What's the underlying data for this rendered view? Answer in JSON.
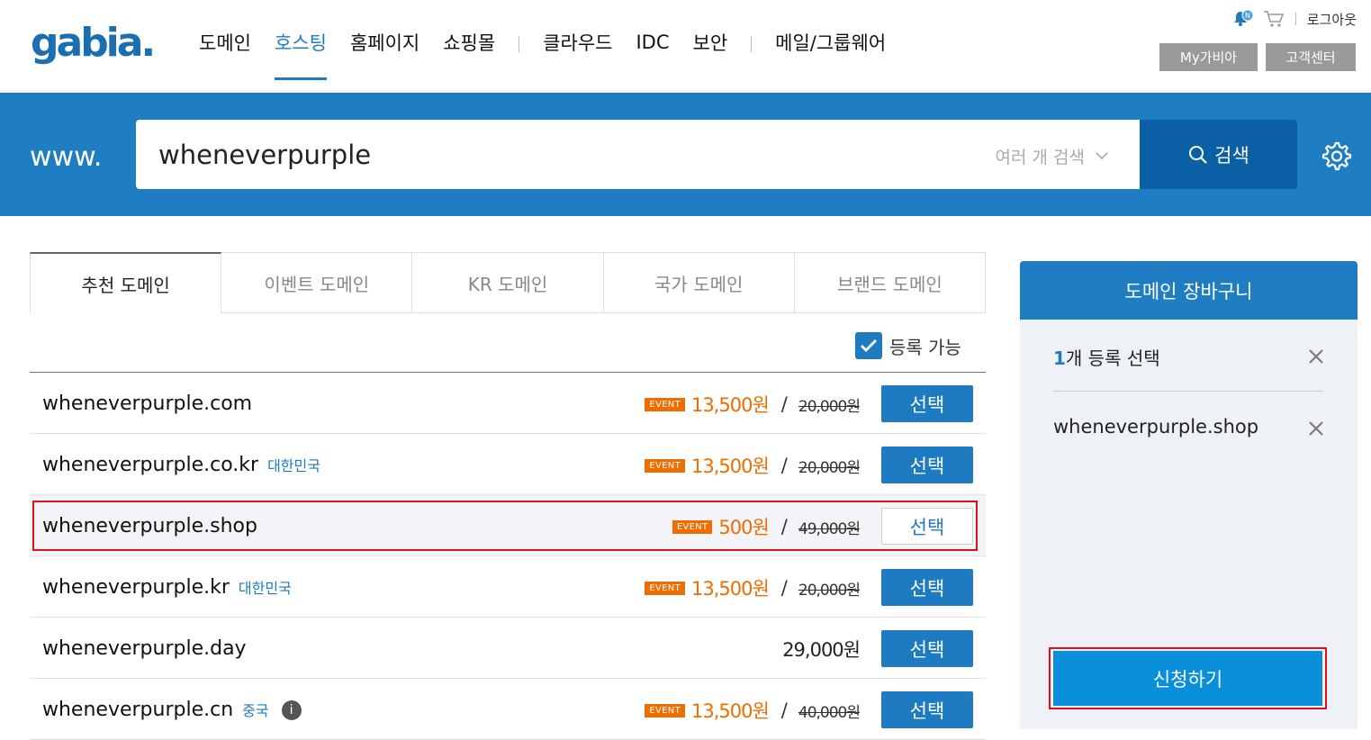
{
  "header": {
    "logo": "gabia.",
    "nav": [
      "도메인",
      "호스팅",
      "홈페이지",
      "쇼핑몰",
      "클라우드",
      "IDC",
      "보안",
      "메일/그룹웨어"
    ],
    "active_nav": "호스팅",
    "logout": "로그아웃",
    "notification_badge": "N",
    "my_gabia": "My가비아",
    "customer_center": "고객센터"
  },
  "search": {
    "prefix": "www.",
    "value": "wheneverpurple",
    "multi_search": "여러 개 검색",
    "button": "검색"
  },
  "tabs": [
    "추천 도메인",
    "이벤트 도메인",
    "KR 도메인",
    "국가 도메인",
    "브랜드 도메인"
  ],
  "filter": {
    "label": "등록 가능",
    "checked": true
  },
  "results": [
    {
      "domain": "wheneverpurple.com",
      "country": "",
      "event": "EVENT",
      "price": "13,500원",
      "original": "20,000원",
      "button": "선택"
    },
    {
      "domain": "wheneverpurple.co.kr",
      "country": "대한민국",
      "event": "EVENT",
      "price": "13,500원",
      "original": "20,000원",
      "button": "선택"
    },
    {
      "domain": "wheneverpurple.shop",
      "country": "",
      "event": "EVENT",
      "price": "500원",
      "original": "49,000원",
      "button": "선택",
      "selected": true
    },
    {
      "domain": "wheneverpurple.kr",
      "country": "대한민국",
      "event": "EVENT",
      "price": "13,500원",
      "original": "20,000원",
      "button": "선택"
    },
    {
      "domain": "wheneverpurple.day",
      "country": "",
      "event": "",
      "price": "29,000원",
      "original": "",
      "button": "선택"
    },
    {
      "domain": "wheneverpurple.cn",
      "country": "중국",
      "event": "EVENT",
      "price": "13,500원",
      "original": "40,000원",
      "button": "선택",
      "info": "i"
    }
  ],
  "cart": {
    "title": "도메인 장바구니",
    "count_number": "1",
    "count_text": "개 등록 선택",
    "items": [
      "wheneverpurple.shop"
    ],
    "apply": "신청하기"
  },
  "colors": {
    "primary": "#1f7ec2",
    "dark_primary": "#0b5fa5",
    "event": "#ef6c00",
    "highlight": "#e0101a"
  }
}
